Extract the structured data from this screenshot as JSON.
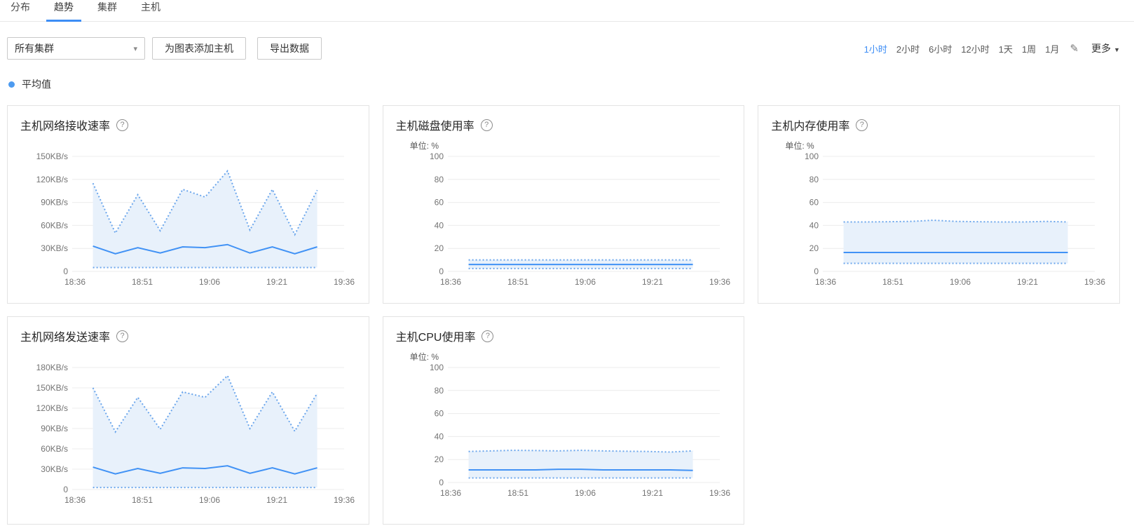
{
  "tabs": {
    "items": [
      {
        "label": "分布",
        "active": false
      },
      {
        "label": "趋势",
        "active": true
      },
      {
        "label": "集群",
        "active": false
      },
      {
        "label": "主机",
        "active": false
      }
    ]
  },
  "toolbar": {
    "cluster_select_value": "所有集群",
    "add_host_button": "为图表添加主机",
    "export_button": "导出数据"
  },
  "timebar": {
    "ranges": [
      {
        "label": "1小时",
        "active": true
      },
      {
        "label": "2小时",
        "active": false
      },
      {
        "label": "6小时",
        "active": false
      },
      {
        "label": "12小时",
        "active": false
      },
      {
        "label": "1天",
        "active": false
      },
      {
        "label": "1周",
        "active": false
      },
      {
        "label": "1月",
        "active": false
      }
    ],
    "more_label": "更多"
  },
  "legend": {
    "average_label": "平均值",
    "dot_color": "#4d9bf0"
  },
  "icons": {
    "help": "?",
    "select_caret": "▾",
    "more_caret": "▼",
    "pencil": "✎"
  },
  "colors": {
    "accent": "#3d8df5",
    "line_solid": "#4192f5",
    "line_dotted": "#6ba6ec",
    "band_fill": "#e8f1fb",
    "grid": "#ececec",
    "axis_text": "#737373"
  },
  "chart_data": [
    {
      "type": "line",
      "title": "主机网络接收速率",
      "unit_label": "",
      "y_ticks": [
        "150KB/s",
        "120KB/s",
        "90KB/s",
        "60KB/s",
        "30KB/s",
        "0"
      ],
      "ylim": [
        0,
        150
      ],
      "x_ticks": [
        "18:36",
        "18:51",
        "19:06",
        "19:21",
        "19:36"
      ],
      "x_domain": [
        0,
        60
      ],
      "x_minutes": [
        4,
        9,
        14,
        19,
        24,
        29,
        34,
        39,
        44,
        49,
        54
      ],
      "grid": true,
      "legend_position": "top-left-page",
      "series": [
        {
          "name": "upper",
          "style": "dotted",
          "values": [
            115,
            50,
            100,
            53,
            107,
            97,
            131,
            54,
            107,
            48,
            106
          ]
        },
        {
          "name": "average",
          "style": "solid",
          "values": [
            33,
            23,
            31,
            24,
            32,
            31,
            35,
            24,
            32,
            23,
            32
          ]
        },
        {
          "name": "lower",
          "style": "dotted",
          "values": [
            5,
            5,
            5,
            5,
            5,
            5,
            5,
            5,
            5,
            5,
            5
          ]
        }
      ]
    },
    {
      "type": "line",
      "title": "主机磁盘使用率",
      "unit_label": "单位: %",
      "y_ticks": [
        "100",
        "80",
        "60",
        "40",
        "20",
        "0"
      ],
      "ylim": [
        0,
        100
      ],
      "x_ticks": [
        "18:36",
        "18:51",
        "19:06",
        "19:21",
        "19:36"
      ],
      "x_domain": [
        0,
        60
      ],
      "x_minutes": [
        4,
        9,
        14,
        19,
        24,
        29,
        34,
        39,
        44,
        49,
        54
      ],
      "grid": true,
      "series": [
        {
          "name": "upper",
          "style": "dotted",
          "values": [
            10,
            10,
            10,
            10,
            10,
            10,
            10,
            10,
            10,
            10,
            10
          ]
        },
        {
          "name": "average",
          "style": "solid",
          "values": [
            6,
            6,
            6,
            6,
            6,
            6,
            6,
            6,
            6,
            6,
            6
          ]
        },
        {
          "name": "lower",
          "style": "dotted",
          "values": [
            2.5,
            2.5,
            2.5,
            2.5,
            2.5,
            2.5,
            2.5,
            2.5,
            2.5,
            2.5,
            2.5
          ]
        }
      ]
    },
    {
      "type": "line",
      "title": "主机内存使用率",
      "unit_label": "单位: %",
      "y_ticks": [
        "100",
        "80",
        "60",
        "40",
        "20",
        "0"
      ],
      "ylim": [
        0,
        100
      ],
      "x_ticks": [
        "18:36",
        "18:51",
        "19:06",
        "19:21",
        "19:36"
      ],
      "x_domain": [
        0,
        60
      ],
      "x_minutes": [
        4,
        9,
        14,
        19,
        24,
        29,
        34,
        39,
        44,
        49,
        54
      ],
      "grid": true,
      "series": [
        {
          "name": "upper",
          "style": "dotted",
          "values": [
            43,
            43,
            43.2,
            43.5,
            44.5,
            43.5,
            43.2,
            43,
            43,
            43.5,
            43
          ]
        },
        {
          "name": "average",
          "style": "solid",
          "values": [
            16.5,
            16.5,
            16.5,
            16.5,
            16.5,
            16.5,
            16.5,
            16.5,
            16.5,
            16.5,
            16.5
          ]
        },
        {
          "name": "lower",
          "style": "dotted",
          "values": [
            7,
            7,
            7,
            7,
            7,
            7,
            7,
            7,
            7,
            7,
            7
          ]
        }
      ]
    },
    {
      "type": "line",
      "title": "主机网络发送速率",
      "unit_label": "",
      "y_ticks": [
        "180KB/s",
        "150KB/s",
        "120KB/s",
        "90KB/s",
        "60KB/s",
        "30KB/s",
        "0"
      ],
      "ylim": [
        0,
        180
      ],
      "x_ticks": [
        "18:36",
        "18:51",
        "19:06",
        "19:21",
        "19:36"
      ],
      "x_domain": [
        0,
        60
      ],
      "x_minutes": [
        4,
        9,
        14,
        19,
        24,
        29,
        34,
        39,
        44,
        49,
        54
      ],
      "grid": true,
      "series": [
        {
          "name": "upper",
          "style": "dotted",
          "values": [
            150,
            85,
            136,
            89,
            144,
            136,
            168,
            90,
            144,
            86,
            142
          ]
        },
        {
          "name": "average",
          "style": "solid",
          "values": [
            33,
            23,
            31,
            24,
            32,
            31,
            35,
            24,
            32,
            23,
            32
          ]
        },
        {
          "name": "lower",
          "style": "dotted",
          "values": [
            3,
            3,
            3,
            3,
            3,
            3,
            3,
            3,
            3,
            3,
            3
          ]
        }
      ]
    },
    {
      "type": "line",
      "title": "主机CPU使用率",
      "unit_label": "单位: %",
      "y_ticks": [
        "100",
        "80",
        "60",
        "40",
        "20",
        "0"
      ],
      "ylim": [
        0,
        100
      ],
      "x_ticks": [
        "18:36",
        "18:51",
        "19:06",
        "19:21",
        "19:36"
      ],
      "x_domain": [
        0,
        60
      ],
      "x_minutes": [
        4,
        9,
        14,
        19,
        24,
        29,
        34,
        39,
        44,
        49,
        54
      ],
      "grid": true,
      "series": [
        {
          "name": "upper",
          "style": "dotted",
          "values": [
            27,
            27.5,
            28,
            27.8,
            27.5,
            28,
            27.5,
            27.2,
            27,
            26.5,
            27.5
          ]
        },
        {
          "name": "average",
          "style": "solid",
          "values": [
            11,
            11,
            11,
            11,
            11.5,
            11.5,
            11,
            11,
            11,
            11,
            10.5
          ]
        },
        {
          "name": "lower",
          "style": "dotted",
          "values": [
            4,
            4,
            4,
            4,
            4,
            4,
            4,
            4,
            4,
            4,
            4
          ]
        }
      ]
    }
  ]
}
